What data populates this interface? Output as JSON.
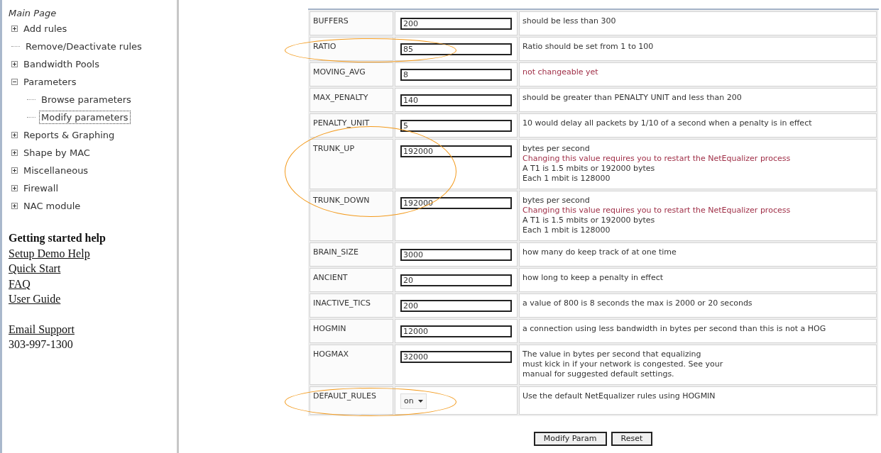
{
  "sidebar": {
    "title": "Main Page",
    "tree": [
      {
        "label": "Add rules",
        "kind": "folder",
        "expanded": false,
        "selected": false
      },
      {
        "label": "Remove/Deactivate rules",
        "kind": "leaf",
        "selected": false
      },
      {
        "label": "Bandwidth Pools",
        "kind": "folder",
        "expanded": false,
        "selected": false
      },
      {
        "label": "Parameters",
        "kind": "folder",
        "expanded": true,
        "selected": false,
        "children": [
          {
            "label": "Browse parameters",
            "kind": "leaf",
            "selected": false
          },
          {
            "label": "Modify parameters",
            "kind": "leaf",
            "selected": true
          }
        ]
      },
      {
        "label": "Reports & Graphing",
        "kind": "folder",
        "expanded": false,
        "selected": false
      },
      {
        "label": "Shape by MAC",
        "kind": "folder",
        "expanded": false,
        "selected": false
      },
      {
        "label": "Miscellaneous",
        "kind": "folder",
        "expanded": false,
        "selected": false
      },
      {
        "label": "Firewall",
        "kind": "folder",
        "expanded": false,
        "selected": false
      },
      {
        "label": "NAC module",
        "kind": "folder",
        "expanded": false,
        "selected": false
      }
    ],
    "help_heading": "Getting started help",
    "help_links": [
      "Setup Demo Help",
      "Quick Start",
      "FAQ",
      "User Guide"
    ],
    "support_link": "Email Support",
    "phone": "303-997-1300"
  },
  "parameters": [
    {
      "name": "BUFFERS",
      "kind": "text",
      "value": "200",
      "circled": false,
      "description": [
        {
          "text": "should be less than 300",
          "kind": "note"
        }
      ]
    },
    {
      "name": "RATIO",
      "kind": "text",
      "value": "85",
      "circled": true,
      "description": [
        {
          "text": "Ratio should be set from 1 to 100",
          "kind": "note"
        }
      ]
    },
    {
      "name": "MOVING_AVG",
      "kind": "text",
      "value": "8",
      "circled": false,
      "description": [
        {
          "text": "not changeable yet",
          "kind": "warning"
        }
      ]
    },
    {
      "name": "MAX_PENALTY",
      "kind": "text",
      "value": "140",
      "circled": false,
      "description": [
        {
          "text": "should be greater than PENALTY UNIT and less than 200",
          "kind": "note"
        }
      ]
    },
    {
      "name": "PENALTY_UNIT",
      "kind": "text",
      "value": "5",
      "circled": false,
      "description": [
        {
          "text": "10 would delay all packets by 1/10 of a second when a penalty is in effect",
          "kind": "note"
        }
      ]
    },
    {
      "name": "TRUNK_UP",
      "kind": "text",
      "value": "192000",
      "circled": true,
      "description": [
        {
          "text": "bytes per second",
          "kind": "note"
        },
        {
          "text": "Changing this value requires you to restart the NetEqualizer process",
          "kind": "warning"
        },
        {
          "text": "A T1 is 1.5 mbits or 192000 bytes",
          "kind": "note"
        },
        {
          "text": "Each 1 mbit is 128000",
          "kind": "note"
        }
      ]
    },
    {
      "name": "TRUNK_DOWN",
      "kind": "text",
      "value": "192000",
      "circled": true,
      "description": [
        {
          "text": "bytes per second",
          "kind": "note"
        },
        {
          "text": "Changing this value requires you to restart the NetEqualizer process",
          "kind": "warning"
        },
        {
          "text": "A T1 is 1.5 mbits or 192000 bytes",
          "kind": "note"
        },
        {
          "text": "Each 1 mbit is 128000",
          "kind": "note"
        }
      ]
    },
    {
      "name": "BRAIN_SIZE",
      "kind": "text",
      "value": "3000",
      "circled": false,
      "description": [
        {
          "text": "how many do keep track of at one time",
          "kind": "note"
        }
      ]
    },
    {
      "name": "ANCIENT",
      "kind": "text",
      "value": "20",
      "circled": false,
      "description": [
        {
          "text": "how long to keep a penalty in effect",
          "kind": "note"
        }
      ]
    },
    {
      "name": "INACTIVE_TICS",
      "kind": "text",
      "value": "200",
      "circled": false,
      "description": [
        {
          "text": "a value of 800 is 8 seconds the max is 2000 or 20 seconds",
          "kind": "note"
        }
      ]
    },
    {
      "name": "HOGMIN",
      "kind": "text",
      "value": "12000",
      "circled": false,
      "description": [
        {
          "text": "a connection using less bandwidth in bytes per second than this is not a HOG",
          "kind": "note"
        }
      ]
    },
    {
      "name": "HOGMAX",
      "kind": "text",
      "value": "32000",
      "circled": false,
      "description": [
        {
          "text": "The value in bytes per second that equalizing",
          "kind": "note"
        },
        {
          "text": "must kick in if your network is congested. See your",
          "kind": "note"
        },
        {
          "text": "manual for suggested default settings.",
          "kind": "note"
        }
      ]
    },
    {
      "name": "DEFAULT_RULES",
      "kind": "select",
      "value": "on",
      "circled": true,
      "description": [
        {
          "text": "Use the default NetEqualizer rules using HOGMIN",
          "kind": "note"
        }
      ]
    }
  ],
  "buttons": [
    "Modify Param",
    "Reset"
  ]
}
